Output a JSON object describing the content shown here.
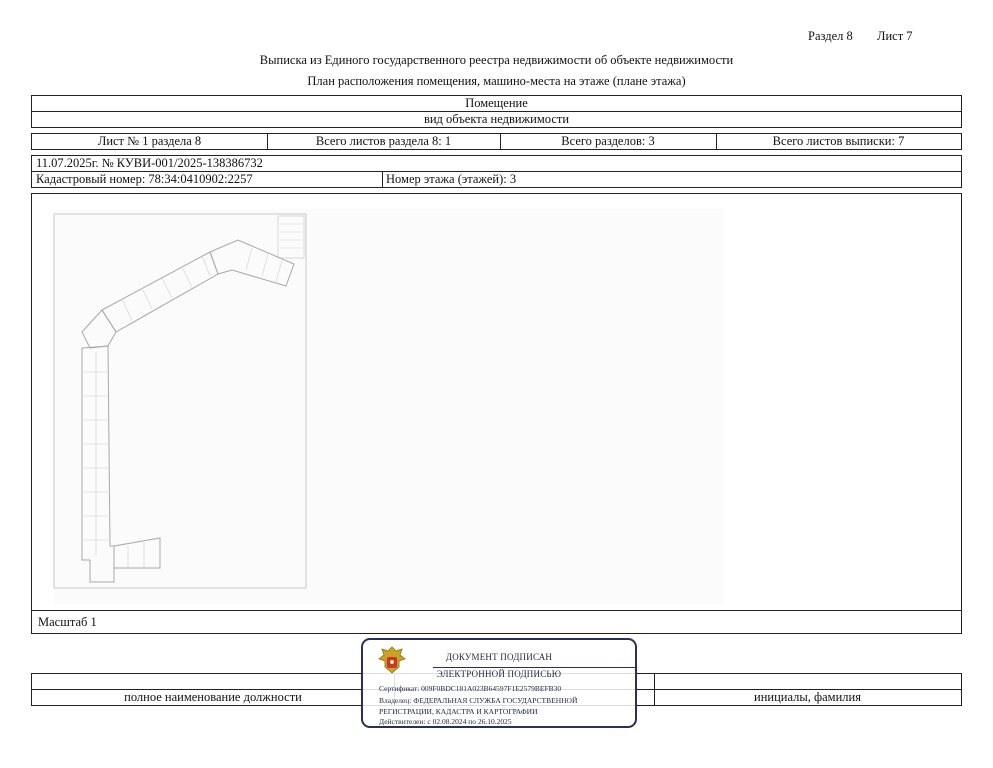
{
  "header": {
    "section": "Раздел 8",
    "sheet": "Лист 7",
    "title_line1": "Выписка из Единого государственного реестра недвижимости об объекте недвижимости",
    "title_line2": "План расположения помещения, машино-места на этаже (плане этажа)"
  },
  "object": {
    "type_value": "Помещение",
    "type_caption": "вид объекта недвижимости"
  },
  "sheets_row": {
    "sheet_no": "Лист № 1 раздела 8",
    "sheets_in_section": "Всего листов раздела 8: 1",
    "sections_total": "Всего разделов: 3",
    "sheets_total": "Всего листов выписки: 7"
  },
  "doc_number": "11.07.2025г. № КУВИ-001/2025-138386732",
  "cadastral": "Кадастровый номер: 78:34:0410902:2257",
  "floor": "Номер этажа (этажей): 3",
  "scale": "Масштаб 1",
  "footer": {
    "position_caption": "полное наименование должности",
    "initials_caption": "инициалы, фамилия"
  },
  "stamp": {
    "title1": "ДОКУМЕНТ ПОДПИСАН",
    "title2": "ЭЛЕКТРОННОЙ ПОДПИСЬЮ",
    "certificate": "Сертификат: 009F0BDC181A023B64597F1E2579BEFB30",
    "owner1": "Владелец: ФЕДЕРАЛЬНАЯ СЛУЖБА ГОСУДАРСТВЕННОЙ",
    "owner2": "РЕГИСТРАЦИИ, КАДАСТРА И КАРТОГРАФИИ",
    "valid": "Действителен: с 02.08.2024 по 26.10.2025",
    "emblem_icon": "coat-of-arms-icon",
    "accent": "#2a3159"
  }
}
